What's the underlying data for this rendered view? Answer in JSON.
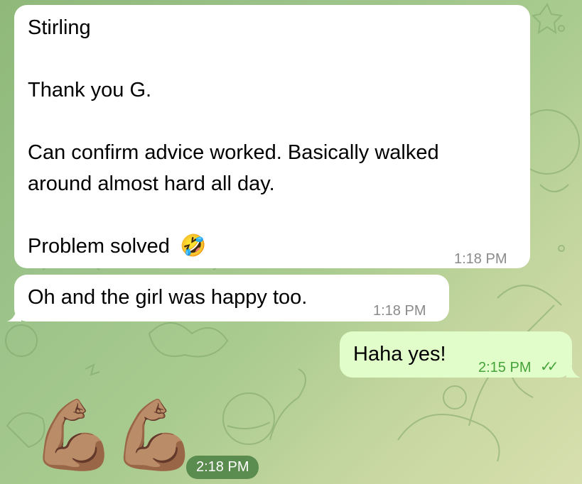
{
  "messages": [
    {
      "lines": [
        "Stirling",
        "",
        "Thank you G.",
        "",
        "Can confirm advice worked. Basically walked",
        "around almost hard all day.",
        "",
        "Problem solved"
      ],
      "emoji": "🤣",
      "time": "1:18 PM"
    },
    {
      "text": "Oh and the girl was happy too.",
      "time": "1:18 PM"
    },
    {
      "text": "Haha yes!",
      "time": "2:15 PM",
      "status": "✓✓"
    },
    {
      "emoji": "💪🏽💪🏽",
      "time": "2:18 PM"
    }
  ],
  "colors": {
    "incoming_bubble": "#ffffff",
    "outgoing_bubble": "#e1fdc9",
    "outgoing_time": "#46a33a",
    "background_start": "#8fb87a",
    "background_end": "#d7dfae"
  }
}
